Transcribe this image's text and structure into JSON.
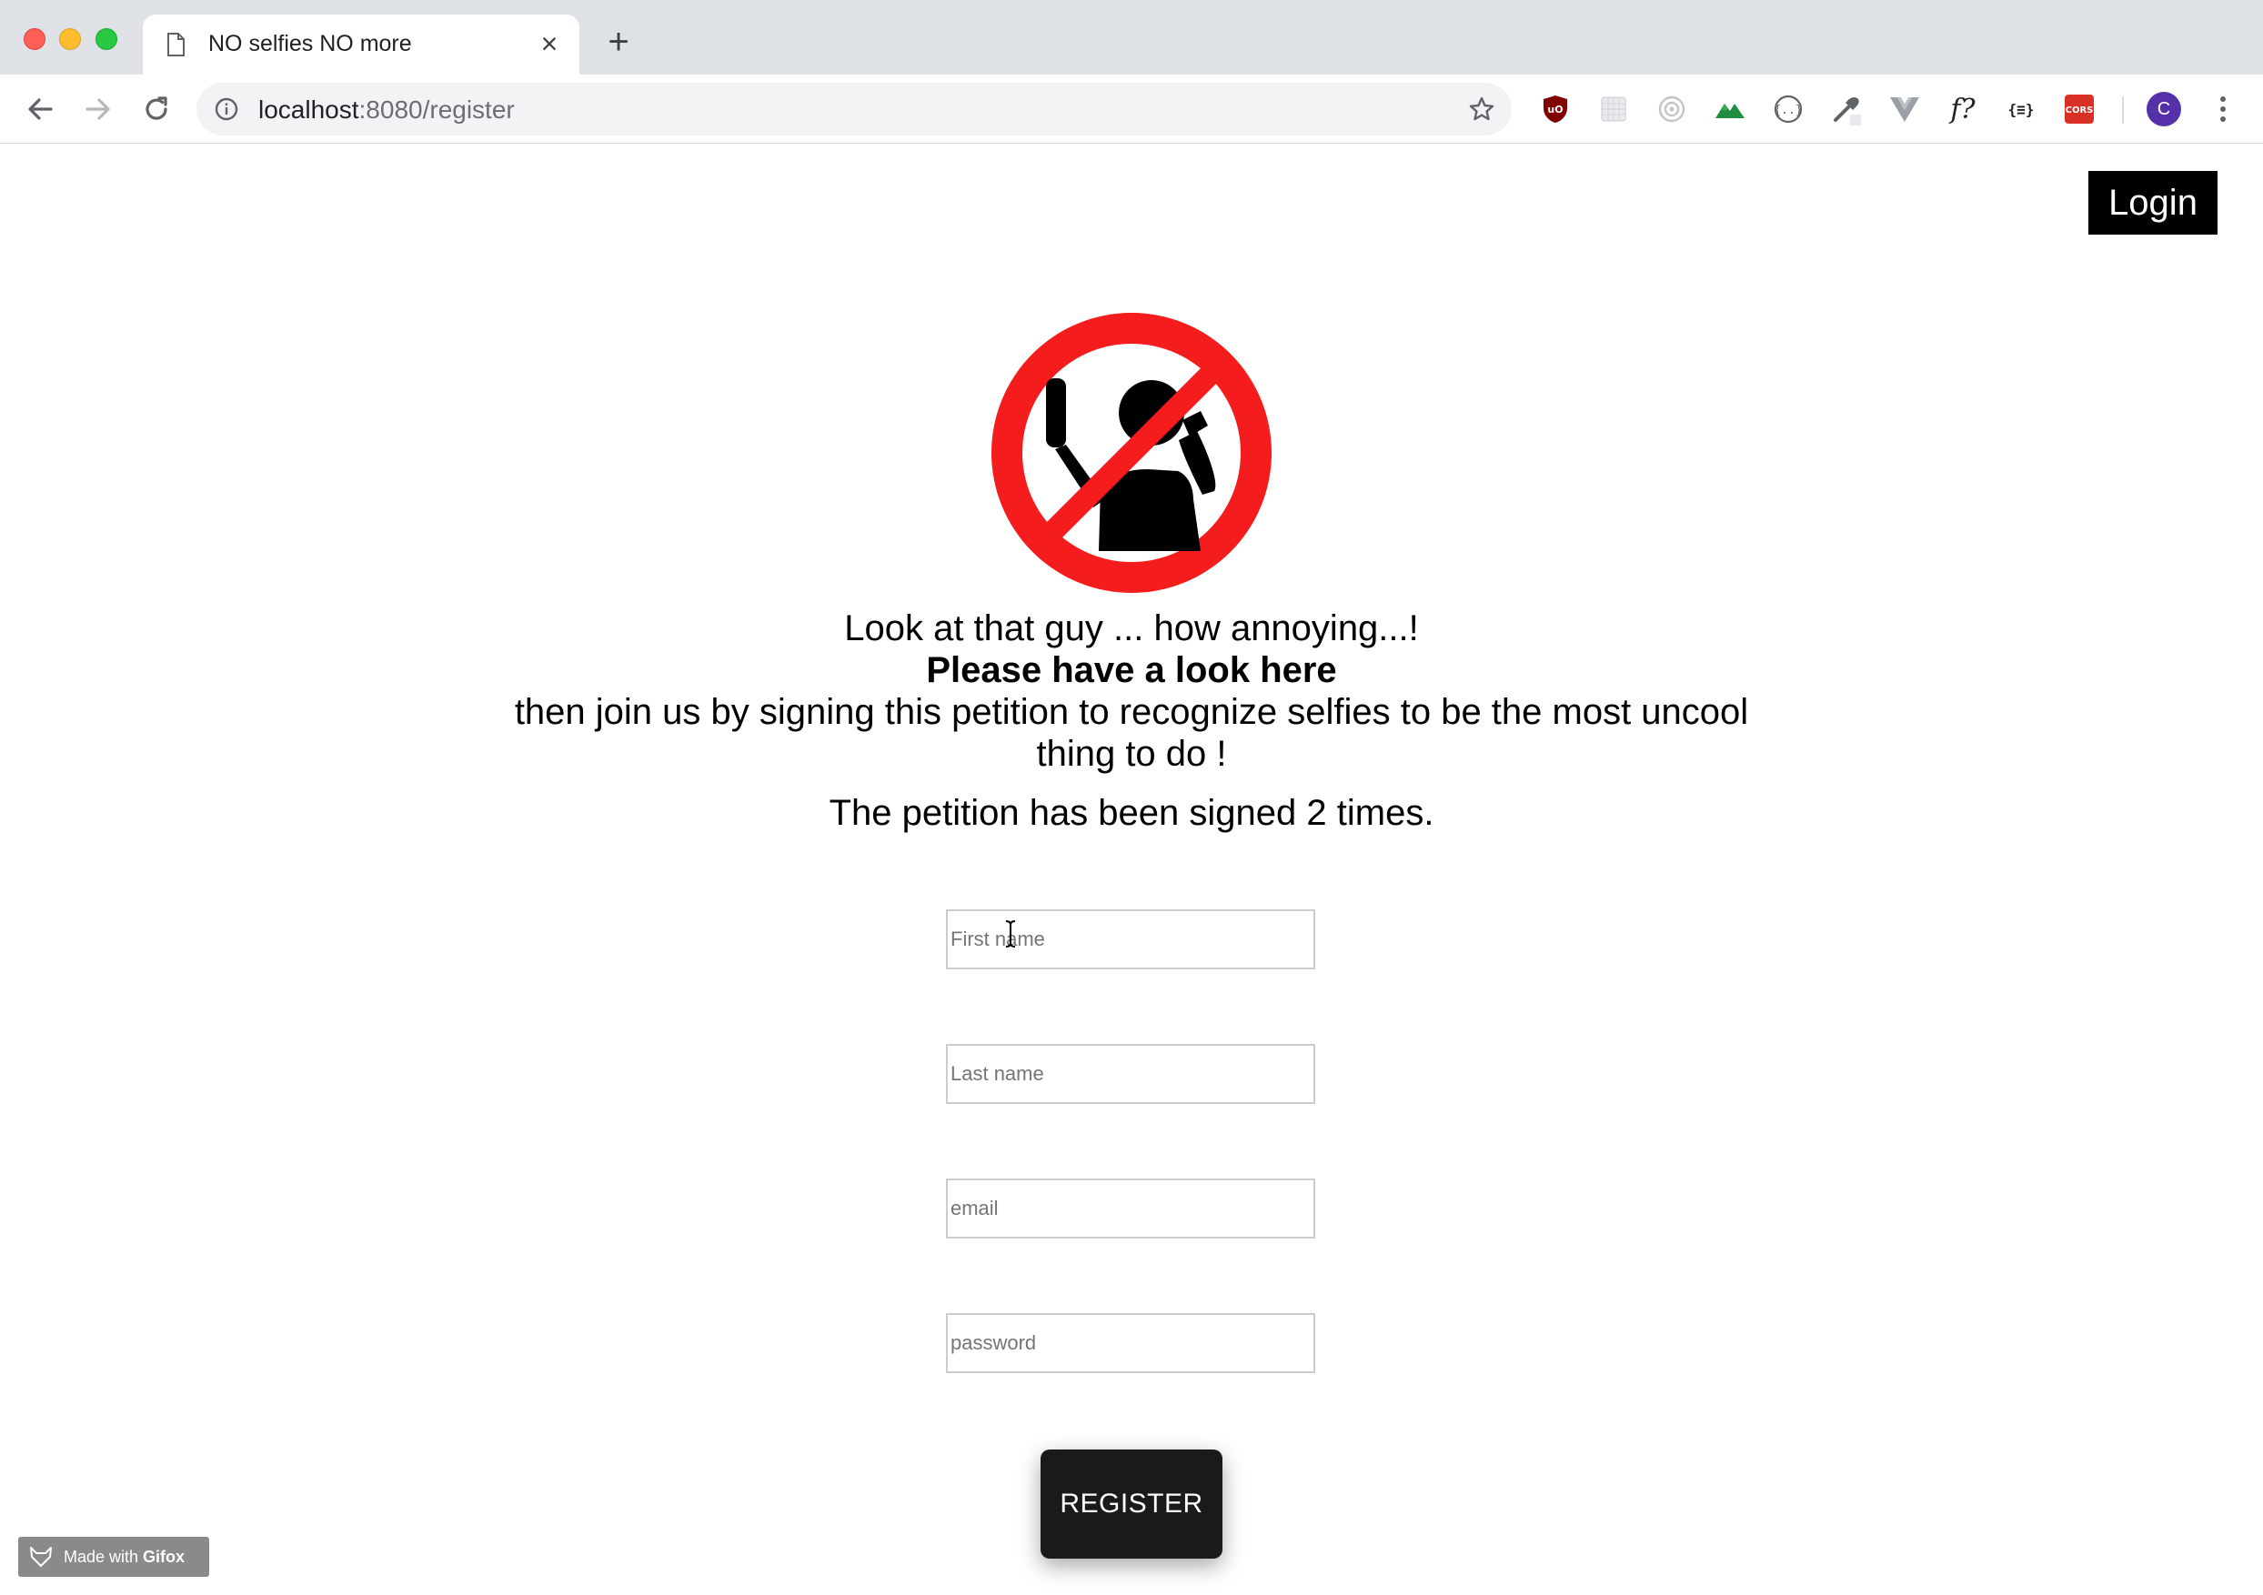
{
  "browser": {
    "tab_title": "NO selfies NO more",
    "close_glyph": "×",
    "newtab_glyph": "+",
    "url_host": "localhost",
    "url_rest": ":8080/register",
    "avatar_letter": "C",
    "extensions": [
      "ublock-icon",
      "extension-grid-icon",
      "target-icon",
      "mountain-icon",
      "json-icon",
      "eyedropper-icon",
      "vue-icon",
      "function-icon",
      "braces-icon",
      "cors-icon"
    ]
  },
  "page": {
    "login_label": "Login",
    "intro_line1": "Look at that guy ... how annoying...!",
    "intro_line2": "Please have a look here",
    "intro_line3": "then join us by signing this petition to recognize selfies to be the most uncool thing to do !",
    "count_text": "The petition has been signed 2 times.",
    "fields": {
      "first_name_placeholder": "First name",
      "last_name_placeholder": "Last name",
      "email_placeholder": "email",
      "password_placeholder": "password"
    },
    "register_label": "REGISTER"
  },
  "watermark": {
    "prefix": "Made with ",
    "brand": "Gifox"
  },
  "colors": {
    "prohibition_red": "#f41c1c",
    "login_bg": "#000000",
    "register_bg": "#1a1a1a",
    "avatar_bg": "#5530a8"
  }
}
